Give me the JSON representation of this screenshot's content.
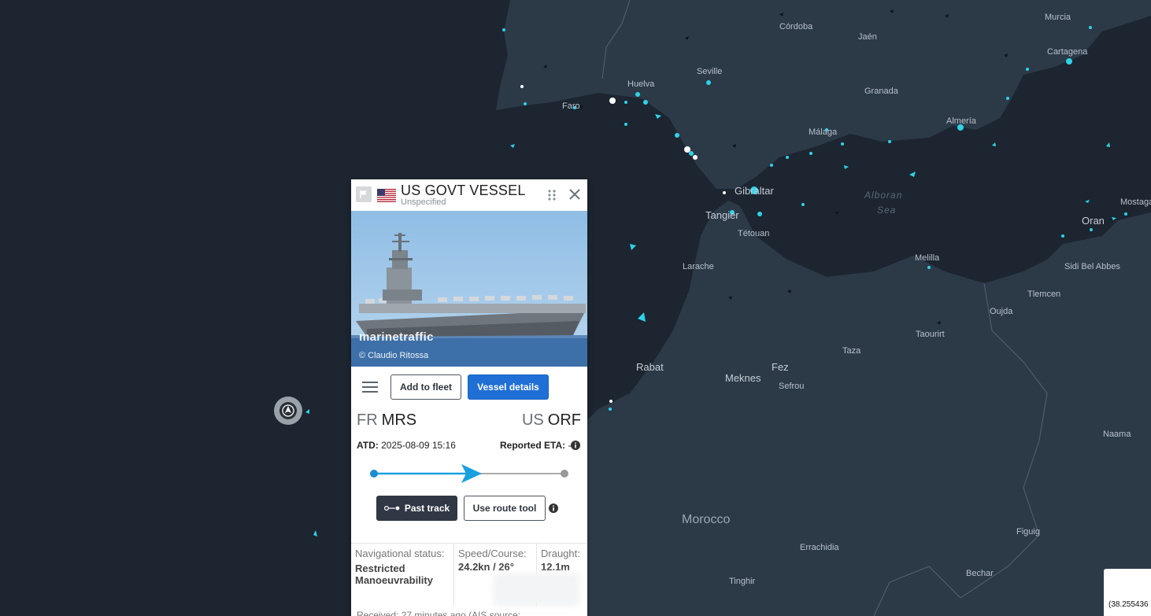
{
  "map": {
    "labels": {
      "murcia": "Murcia",
      "cordoba": "Córdoba",
      "jaen": "Jaén",
      "cartagena": "Cartagena",
      "seville": "Seville",
      "huelva": "Huelva",
      "granada": "Granada",
      "faro": "Faro",
      "almeria": "Almería",
      "malaga": "Málaga",
      "gibraltar": "Gibraltar",
      "tangier": "Tangier",
      "tetouan": "Tétouan",
      "alboran_sea": "Alboran",
      "alboran_sea2": "Sea",
      "oran": "Oran",
      "mostaganem": "Mostaga",
      "melilla": "Melilla",
      "sidi_bel_abbes": "Sidi Bel Abbes",
      "larache": "Larache",
      "tlemcen": "Tlemcen",
      "oujda": "Oujda",
      "taourirt": "Taourirt",
      "taza": "Taza",
      "rabat": "Rabat",
      "fez": "Fez",
      "meknes": "Meknes",
      "sefrou": "Sefrou",
      "naama": "Naama",
      "morocco": "Morocco",
      "figuig": "Figuig",
      "errachidia": "Errachidia",
      "bechar": "Bechar",
      "tinghir": "Tinghir"
    },
    "coordinates_readout": "(38.255436"
  },
  "panel": {
    "vessel_name": "US GOVT VESSEL",
    "vessel_type": "Unspecified",
    "photo_watermark": "marinetraffic",
    "photo_credit": "© Claudio Ritossa",
    "add_to_fleet": "Add to fleet",
    "vessel_details": "Vessel details",
    "departure": {
      "country": "FR",
      "port": "MRS"
    },
    "arrival": {
      "country": "US",
      "port": "ORF"
    },
    "atd_label": "ATD:",
    "atd_value": "2025-08-09 15:16",
    "eta_label": "Reported ETA:",
    "eta_value": "-",
    "past_track": "Past track",
    "route_tool": "Use route tool",
    "nav_status_label": "Navigational status:",
    "nav_status_value": "Restricted Manoeuvrability",
    "speed_label": "Speed/Course:",
    "speed_value": "24.2kn / 26°",
    "draught_label": "Draught:",
    "draught_value": "12.1m",
    "received_text": "Received: 27 minutes ago (AIS source:"
  },
  "colors": {
    "map_water": "#1c2530",
    "map_land": "#2c3a48",
    "vessel_cyan": "#2ed3e8",
    "primary_button": "#1f6fd6",
    "route_line": "#1aa0e0"
  }
}
